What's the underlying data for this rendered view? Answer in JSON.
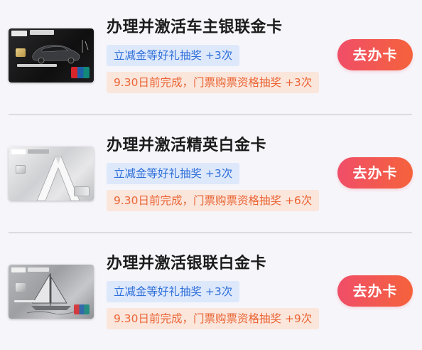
{
  "items": [
    {
      "title": "办理并激活车主银联金卡",
      "tag_blue": "立减金等好礼抽奖 +3次",
      "tag_orange": "9.30日前完成，门票购票资格抽奖 +3次",
      "button": "去办卡"
    },
    {
      "title": "办理并激活精英白金卡",
      "tag_blue": "立减金等好礼抽奖 +3次",
      "tag_orange": "9.30日前完成，门票购票资格抽奖 +6次",
      "button": "去办卡"
    },
    {
      "title": "办理并激活银联白金卡",
      "tag_blue": "立减金等好礼抽奖 +3次",
      "tag_orange": "9.30日前完成，门票购票资格抽奖 +9次",
      "button": "去办卡"
    }
  ],
  "colors": {
    "button_gradient_start": "#f04e68",
    "button_gradient_end": "#f5623c",
    "tag_blue_bg": "#dde8fb",
    "tag_blue_text": "#2f6fd9",
    "tag_orange_bg": "#fbe6dc",
    "tag_orange_text": "#ea6535"
  }
}
